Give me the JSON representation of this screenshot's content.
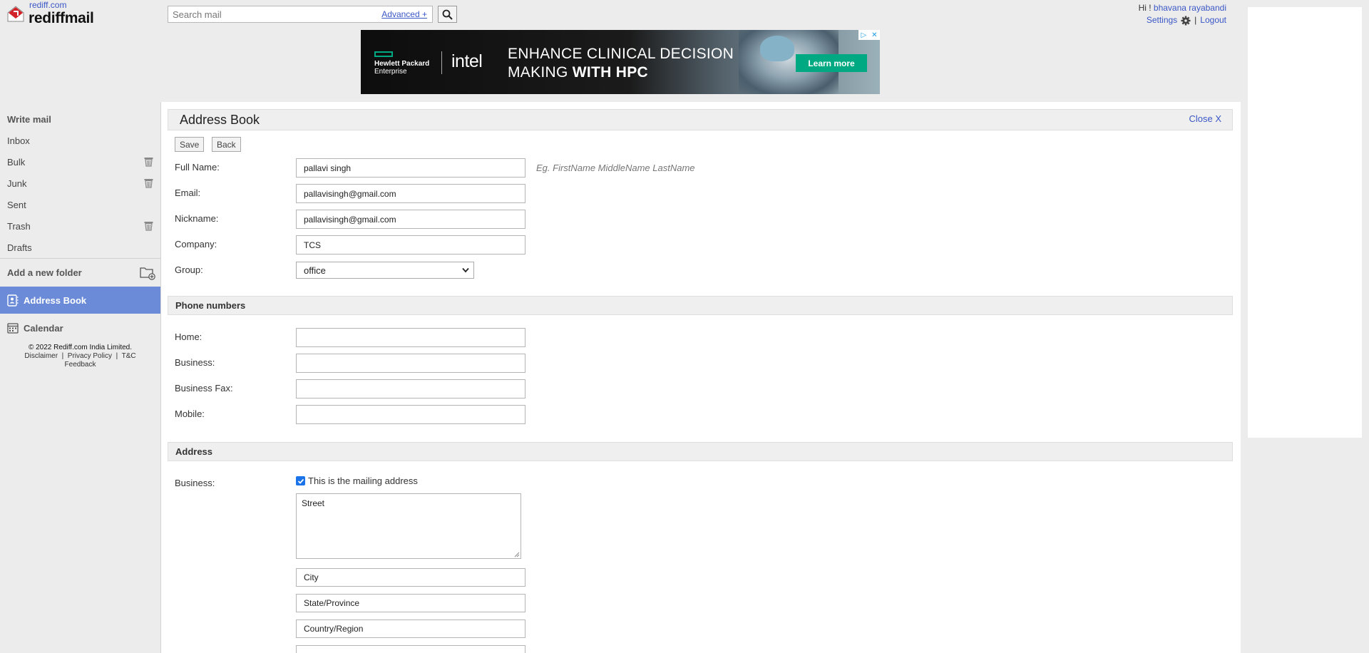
{
  "header": {
    "logo_small": "rediff.com",
    "logo_main": "rediffmail",
    "search_placeholder": "Search mail",
    "advanced_label": "Advanced +",
    "user_greeting": "Hi !",
    "user_name": "bhavana rayabandi",
    "settings_label": "Settings",
    "separator": "|",
    "logout_label": "Logout"
  },
  "ad": {
    "brand_line1": "Hewlett Packard",
    "brand_line2": "Enterprise",
    "partner": "intel",
    "headline_line1": "ENHANCE CLINICAL DECISION",
    "headline_line2_prefix": "MAKING ",
    "headline_line2_bold": "WITH HPC",
    "cta": "Learn more"
  },
  "sidebar": {
    "write_mail": "Write mail",
    "items": [
      {
        "label": "Inbox"
      },
      {
        "label": "Bulk"
      },
      {
        "label": "Junk"
      },
      {
        "label": "Sent"
      },
      {
        "label": "Trash"
      },
      {
        "label": "Drafts"
      }
    ],
    "add_folder": "Add a new folder",
    "address_book": "Address Book",
    "calendar": "Calendar",
    "footer": {
      "copyright": "© 2022 Rediff.com India Limited.",
      "disclaimer": "Disclaimer",
      "sep": "|",
      "privacy": "Privacy Policy",
      "tc": "T&C",
      "feedback": "Feedback"
    }
  },
  "main": {
    "title": "Address Book",
    "close_label": "Close X",
    "save_label": "Save",
    "back_label": "Back",
    "fields": {
      "full_name_label": "Full Name:",
      "full_name_value": "pallavi singh",
      "full_name_hint": "Eg. FirstName MiddleName LastName",
      "email_label": "Email:",
      "email_value": "pallavisingh@gmail.com",
      "nickname_label": "Nickname:",
      "nickname_value": "pallavisingh@gmail.com",
      "company_label": "Company:",
      "company_value": "TCS",
      "group_label": "Group:",
      "group_value": "office"
    },
    "phone_section": {
      "title": "Phone numbers",
      "home_label": "Home:",
      "home_value": "",
      "business_label": "Business:",
      "business_value": "",
      "fax_label": "Business Fax:",
      "fax_value": "",
      "mobile_label": "Mobile:",
      "mobile_value": ""
    },
    "address_section": {
      "title": "Address",
      "business_label": "Business:",
      "mailing_checkbox_label": "This is the mailing address",
      "mailing_checked": true,
      "street_value": "Street",
      "city_value": "City",
      "state_value": "State/Province",
      "country_value": "Country/Region"
    }
  }
}
